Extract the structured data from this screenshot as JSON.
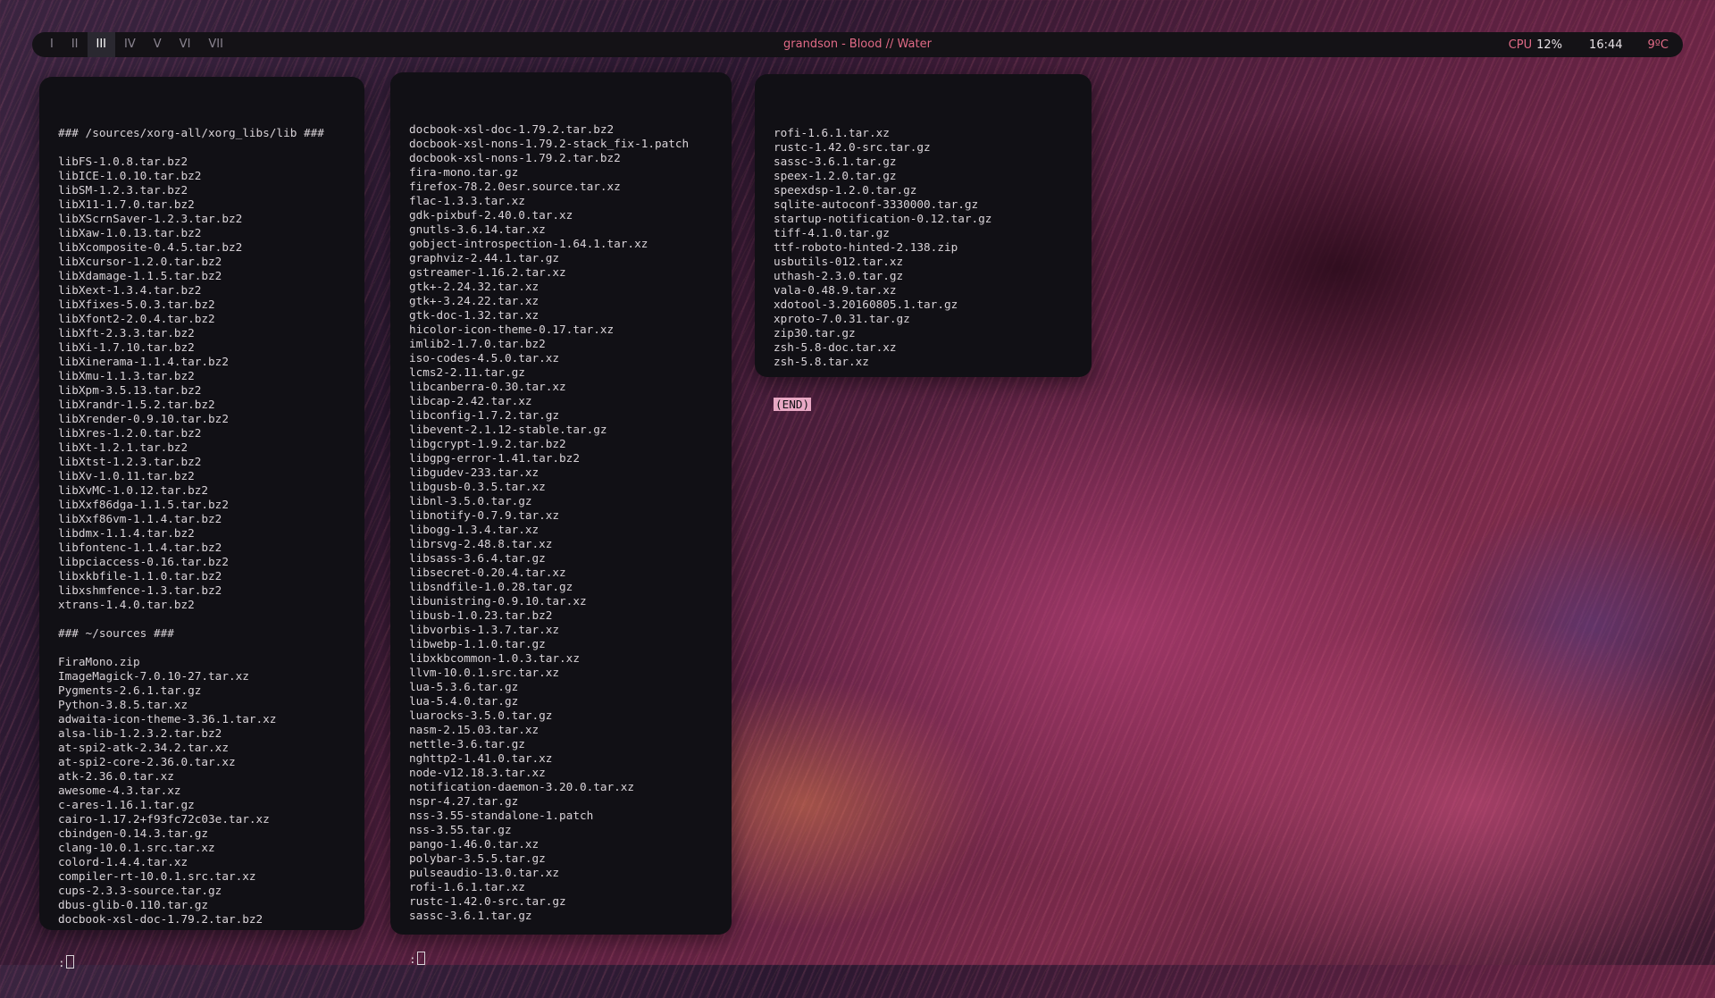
{
  "bar": {
    "workspaces": [
      "I",
      "II",
      "III",
      "IV",
      "V",
      "VI",
      "VII"
    ],
    "active_workspace": "III",
    "title_artist": "grandson",
    "title_separator": "-",
    "title_song": "Blood // Water",
    "cpu_label": "CPU",
    "cpu_value": "12%",
    "clock": "16:44",
    "temperature": "9ºC",
    "accent_color": "#e06a86"
  },
  "terminals": {
    "left": {
      "lines": [
        "### /sources/xorg-all/xorg_libs/lib ###",
        "",
        "libFS-1.0.8.tar.bz2",
        "libICE-1.0.10.tar.bz2",
        "libSM-1.2.3.tar.bz2",
        "libX11-1.7.0.tar.bz2",
        "libXScrnSaver-1.2.3.tar.bz2",
        "libXaw-1.0.13.tar.bz2",
        "libXcomposite-0.4.5.tar.bz2",
        "libXcursor-1.2.0.tar.bz2",
        "libXdamage-1.1.5.tar.bz2",
        "libXext-1.3.4.tar.bz2",
        "libXfixes-5.0.3.tar.bz2",
        "libXfont2-2.0.4.tar.bz2",
        "libXft-2.3.3.tar.bz2",
        "libXi-1.7.10.tar.bz2",
        "libXinerama-1.1.4.tar.bz2",
        "libXmu-1.1.3.tar.bz2",
        "libXpm-3.5.13.tar.bz2",
        "libXrandr-1.5.2.tar.bz2",
        "libXrender-0.9.10.tar.bz2",
        "libXres-1.2.0.tar.bz2",
        "libXt-1.2.1.tar.bz2",
        "libXtst-1.2.3.tar.bz2",
        "libXv-1.0.11.tar.bz2",
        "libXvMC-1.0.12.tar.bz2",
        "libXxf86dga-1.1.5.tar.bz2",
        "libXxf86vm-1.1.4.tar.bz2",
        "libdmx-1.1.4.tar.bz2",
        "libfontenc-1.1.4.tar.bz2",
        "libpciaccess-0.16.tar.bz2",
        "libxkbfile-1.1.0.tar.bz2",
        "libxshmfence-1.3.tar.bz2",
        "xtrans-1.4.0.tar.bz2",
        "",
        "### ~/sources ###",
        "",
        "FiraMono.zip",
        "ImageMagick-7.0.10-27.tar.xz",
        "Pygments-2.6.1.tar.gz",
        "Python-3.8.5.tar.xz",
        "adwaita-icon-theme-3.36.1.tar.xz",
        "alsa-lib-1.2.3.2.tar.bz2",
        "at-spi2-atk-2.34.2.tar.xz",
        "at-spi2-core-2.36.0.tar.xz",
        "atk-2.36.0.tar.xz",
        "awesome-4.3.tar.xz",
        "c-ares-1.16.1.tar.gz",
        "cairo-1.17.2+f93fc72c03e.tar.xz",
        "cbindgen-0.14.3.tar.gz",
        "clang-10.0.1.src.tar.xz",
        "colord-1.4.4.tar.xz",
        "compiler-rt-10.0.1.src.tar.xz",
        "cups-2.3.3-source.tar.gz",
        "dbus-glib-0.110.tar.gz",
        "docbook-xsl-doc-1.79.2.tar.bz2"
      ],
      "prompt": ":"
    },
    "middle": {
      "lines": [
        "docbook-xsl-doc-1.79.2.tar.bz2",
        "docbook-xsl-nons-1.79.2-stack_fix-1.patch",
        "docbook-xsl-nons-1.79.2.tar.bz2",
        "fira-mono.tar.gz",
        "firefox-78.2.0esr.source.tar.xz",
        "flac-1.3.3.tar.xz",
        "gdk-pixbuf-2.40.0.tar.xz",
        "gnutls-3.6.14.tar.xz",
        "gobject-introspection-1.64.1.tar.xz",
        "graphviz-2.44.1.tar.gz",
        "gstreamer-1.16.2.tar.xz",
        "gtk+-2.24.32.tar.xz",
        "gtk+-3.24.22.tar.xz",
        "gtk-doc-1.32.tar.xz",
        "hicolor-icon-theme-0.17.tar.xz",
        "imlib2-1.7.0.tar.bz2",
        "iso-codes-4.5.0.tar.xz",
        "lcms2-2.11.tar.gz",
        "libcanberra-0.30.tar.xz",
        "libcap-2.42.tar.xz",
        "libconfig-1.7.2.tar.gz",
        "libevent-2.1.12-stable.tar.gz",
        "libgcrypt-1.9.2.tar.bz2",
        "libgpg-error-1.41.tar.bz2",
        "libgudev-233.tar.xz",
        "libgusb-0.3.5.tar.xz",
        "libnl-3.5.0.tar.gz",
        "libnotify-0.7.9.tar.xz",
        "libogg-1.3.4.tar.xz",
        "librsvg-2.48.8.tar.xz",
        "libsass-3.6.4.tar.gz",
        "libsecret-0.20.4.tar.xz",
        "libsndfile-1.0.28.tar.gz",
        "libunistring-0.9.10.tar.xz",
        "libusb-1.0.23.tar.bz2",
        "libvorbis-1.3.7.tar.xz",
        "libwebp-1.1.0.tar.gz",
        "libxkbcommon-1.0.3.tar.xz",
        "llvm-10.0.1.src.tar.xz",
        "lua-5.3.6.tar.gz",
        "lua-5.4.0.tar.gz",
        "luarocks-3.5.0.tar.gz",
        "nasm-2.15.03.tar.xz",
        "nettle-3.6.tar.gz",
        "nghttp2-1.41.0.tar.xz",
        "node-v12.18.3.tar.xz",
        "notification-daemon-3.20.0.tar.xz",
        "nspr-4.27.tar.gz",
        "nss-3.55-standalone-1.patch",
        "nss-3.55.tar.gz",
        "pango-1.46.0.tar.xz",
        "polybar-3.5.5.tar.gz",
        "pulseaudio-13.0.tar.xz",
        "rofi-1.6.1.tar.xz",
        "rustc-1.42.0-src.tar.gz",
        "sassc-3.6.1.tar.gz"
      ],
      "prompt": ":"
    },
    "right": {
      "lines": [
        "rofi-1.6.1.tar.xz",
        "rustc-1.42.0-src.tar.gz",
        "sassc-3.6.1.tar.gz",
        "speex-1.2.0.tar.gz",
        "speexdsp-1.2.0.tar.gz",
        "sqlite-autoconf-3330000.tar.gz",
        "startup-notification-0.12.tar.gz",
        "tiff-4.1.0.tar.gz",
        "ttf-roboto-hinted-2.138.zip",
        "usbutils-012.tar.xz",
        "uthash-2.3.0.tar.gz",
        "vala-0.48.9.tar.xz",
        "xdotool-3.20160805.1.tar.gz",
        "xproto-7.0.31.tar.gz",
        "zip30.tar.gz",
        "zsh-5.8-doc.tar.xz",
        "zsh-5.8.tar.xz"
      ],
      "end_marker": "(END)"
    }
  }
}
